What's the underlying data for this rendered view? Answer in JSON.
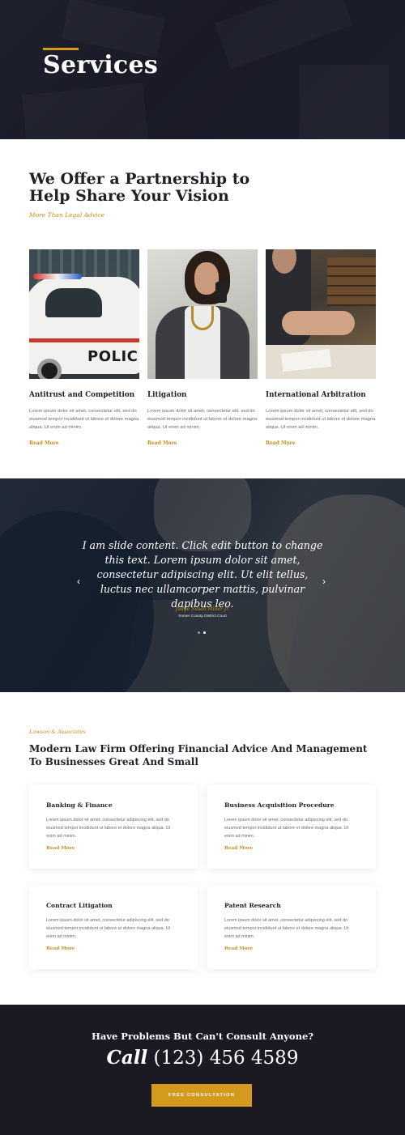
{
  "hero": {
    "title": "Services"
  },
  "intro": {
    "heading": "We Offer a Partnership to Help Share Your Vision",
    "subheading": "More Than Legal Advice"
  },
  "services": [
    {
      "title": "Antitrust and Competition",
      "body": "Lorem ipsum dolor sit amet, consectetur elit, sed do eiusmod tempor incididunt ut labore et dolore magna aliqua. Ut enim ad minim.",
      "link": "Read More",
      "image_word": "POLICE"
    },
    {
      "title": "Litigation",
      "body": "Lorem ipsum dolor sit amet, consectetur elit, sed do eiusmod tempor incididunt ut labore et dolore magna aliqua. Ut enim ad minim.",
      "link": "Read More"
    },
    {
      "title": "International Arbitration",
      "body": "Lorem ipsum dolor sit amet, consectetur elit, sed do eiusmod tempor incididunt ut labore et dolore magna aliqua. Ut enim ad minim.",
      "link": "Read More"
    }
  ],
  "slider": {
    "quote": "I am slide content. Click edit button to change this text. Lorem ipsum dolor sit amet, consectetur adipiscing elit. Ut elit tellus, luctus nec ullamcorper mattis, pulvinar dapibus leo.",
    "author": "Judge Susan Miller Jr.",
    "role": "Somer County District Court",
    "prev_icon": "‹",
    "next_icon": "›"
  },
  "practice": {
    "tag": "Lawson & Associates",
    "heading": "Modern Law Firm Offering Financial Advice And Management To Businesses Great And Small",
    "cards": [
      {
        "title": "Banking & Finance",
        "body": "Lorem ipsum dolor sit amet, consectetur adipiscing elit, sed do eiusmod tempor incididunt ut labore et dolore magna aliqua. Ut enim ad minim.",
        "link": "Read More"
      },
      {
        "title": "Business Acquisition Procedure",
        "body": "Lorem ipsum dolor sit amet, consectetur adipiscing elit, sed do eiusmod tempor incididunt ut labore et dolore magna aliqua. Ut enim ad minim.",
        "link": "Read More"
      },
      {
        "title": "Contract Litigation",
        "body": "Lorem ipsum dolor sit amet, consectetur adipiscing elit, sed do eiusmod tempor incididunt ut labore et dolore magna aliqua. Ut enim ad minim.",
        "link": "Read More"
      },
      {
        "title": "Patent Research",
        "body": "Lorem ipsum dolor sit amet, consectetur adipiscing elit, sed do eiusmod tempor incididunt ut labore et dolore magna aliqua. Ut enim ad minim.",
        "link": "Read More"
      }
    ]
  },
  "cta": {
    "question": "Have Problems But Can't Consult Anyone?",
    "call_label": "Call",
    "phone": "(123) 456 4589",
    "button": "FREE CONSULTATION"
  },
  "colors": {
    "accent": "#d39a1e",
    "dark": "#1b1a22",
    "heading": "#1f1f28"
  }
}
